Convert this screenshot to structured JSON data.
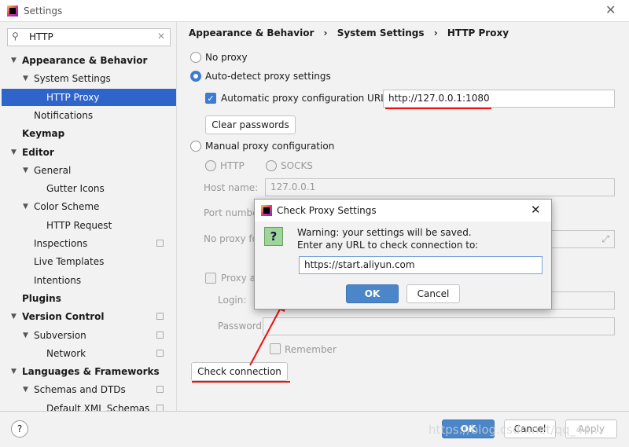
{
  "window": {
    "title": "Settings"
  },
  "search": {
    "value": "HTTP"
  },
  "tree": [
    {
      "label": "Appearance & Behavior",
      "level": 0,
      "bold": true,
      "arrow": true
    },
    {
      "label": "System Settings",
      "level": 1,
      "arrow": true
    },
    {
      "label": "HTTP Proxy",
      "level": 2,
      "selected": true
    },
    {
      "label": "Notifications",
      "level": 1
    },
    {
      "label": "Keymap",
      "level": 0,
      "bold": true
    },
    {
      "label": "Editor",
      "level": 0,
      "bold": true,
      "arrow": true
    },
    {
      "label": "General",
      "level": 1,
      "arrow": true
    },
    {
      "label": "Gutter Icons",
      "level": 2
    },
    {
      "label": "Color Scheme",
      "level": 1,
      "arrow": true
    },
    {
      "label": "HTTP Request",
      "level": 2
    },
    {
      "label": "Inspections",
      "level": 1,
      "copy": true
    },
    {
      "label": "Live Templates",
      "level": 1
    },
    {
      "label": "Intentions",
      "level": 1
    },
    {
      "label": "Plugins",
      "level": 0,
      "bold": true
    },
    {
      "label": "Version Control",
      "level": 0,
      "bold": true,
      "arrow": true,
      "copy": true
    },
    {
      "label": "Subversion",
      "level": 1,
      "arrow": true,
      "copy": true
    },
    {
      "label": "Network",
      "level": 2,
      "copy": true
    },
    {
      "label": "Languages & Frameworks",
      "level": 0,
      "bold": true,
      "arrow": true
    },
    {
      "label": "Schemas and DTDs",
      "level": 1,
      "arrow": true,
      "copy": true
    },
    {
      "label": "Default XML Schemas",
      "level": 2,
      "copy": true
    }
  ],
  "breadcrumb": [
    "Appearance & Behavior",
    "System Settings",
    "HTTP Proxy"
  ],
  "proxy": {
    "no_proxy": "No proxy",
    "auto_detect": "Auto-detect proxy settings",
    "auto_config_label": "Automatic proxy configuration URL:",
    "auto_config_url": "http://127.0.0.1:1080",
    "clear_passwords": "Clear passwords",
    "manual": "Manual proxy configuration",
    "http": "HTTP",
    "socks": "SOCKS",
    "host_label": "Host name:",
    "host_value": "127.0.0.1",
    "port_label": "Port number:",
    "no_proxy_for_label": "No proxy for:",
    "proxy_auth_label": "Proxy authentication",
    "login_label": "Login:",
    "password_label": "Password:",
    "remember": "Remember",
    "check_connection": "Check connection"
  },
  "dialog": {
    "title": "Check Proxy Settings",
    "line1": "Warning: your settings will be saved.",
    "line2": "Enter any URL to check connection to:",
    "url": "https://start.aliyun.com",
    "ok": "OK",
    "cancel": "Cancel",
    "icon": "question-icon"
  },
  "footer": {
    "help": "?",
    "ok": "OK",
    "cancel": "Cancel",
    "apply": "Apply"
  },
  "watermark": "https://blog.csdn.net/qq_44..."
}
